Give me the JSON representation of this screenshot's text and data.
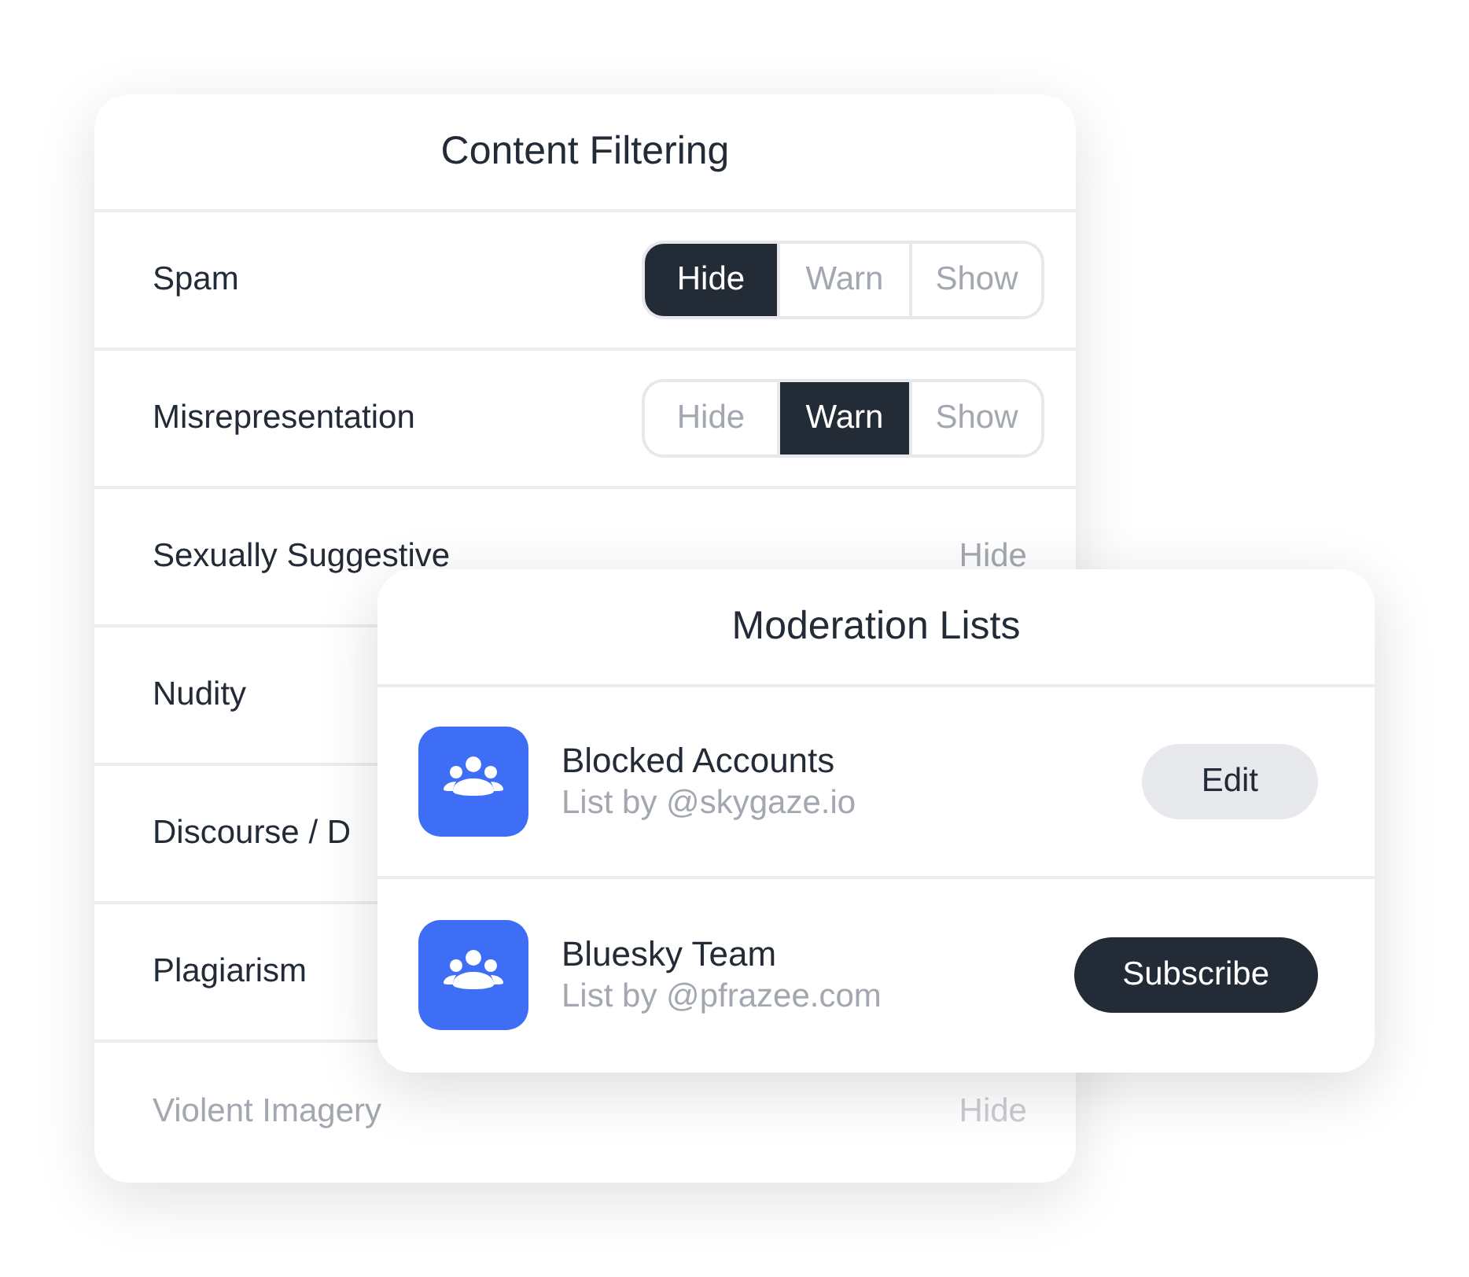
{
  "filter_card": {
    "title": "Content Filtering",
    "rows": [
      {
        "label": "Spam",
        "kind": "segmented",
        "faded": false,
        "options": [
          {
            "label": "Hide",
            "selected": true
          },
          {
            "label": "Warn",
            "selected": false
          },
          {
            "label": "Show",
            "selected": false
          }
        ]
      },
      {
        "label": "Misrepresentation",
        "kind": "segmented",
        "faded": false,
        "options": [
          {
            "label": "Hide",
            "selected": false
          },
          {
            "label": "Warn",
            "selected": true
          },
          {
            "label": "Show",
            "selected": false
          }
        ]
      },
      {
        "label": "Sexually Suggestive",
        "kind": "value",
        "faded": false,
        "value": "Hide"
      },
      {
        "label": "Nudity",
        "kind": "plain",
        "faded": false
      },
      {
        "label": "Discourse / D",
        "kind": "plain",
        "faded": false
      },
      {
        "label": "Plagiarism",
        "kind": "plain",
        "faded": false
      },
      {
        "label": "Violent Imagery",
        "kind": "value",
        "faded": true,
        "value": "Hide"
      }
    ]
  },
  "lists_card": {
    "title": "Moderation Lists",
    "lists": [
      {
        "name": "Blocked Accounts",
        "byline": "List by @skygaze.io",
        "action": {
          "label": "Edit",
          "kind": "secondary"
        }
      },
      {
        "name": "Bluesky Team",
        "byline": "List by @pfrazee.com",
        "action": {
          "label": "Subscribe",
          "kind": "primary"
        }
      }
    ]
  }
}
